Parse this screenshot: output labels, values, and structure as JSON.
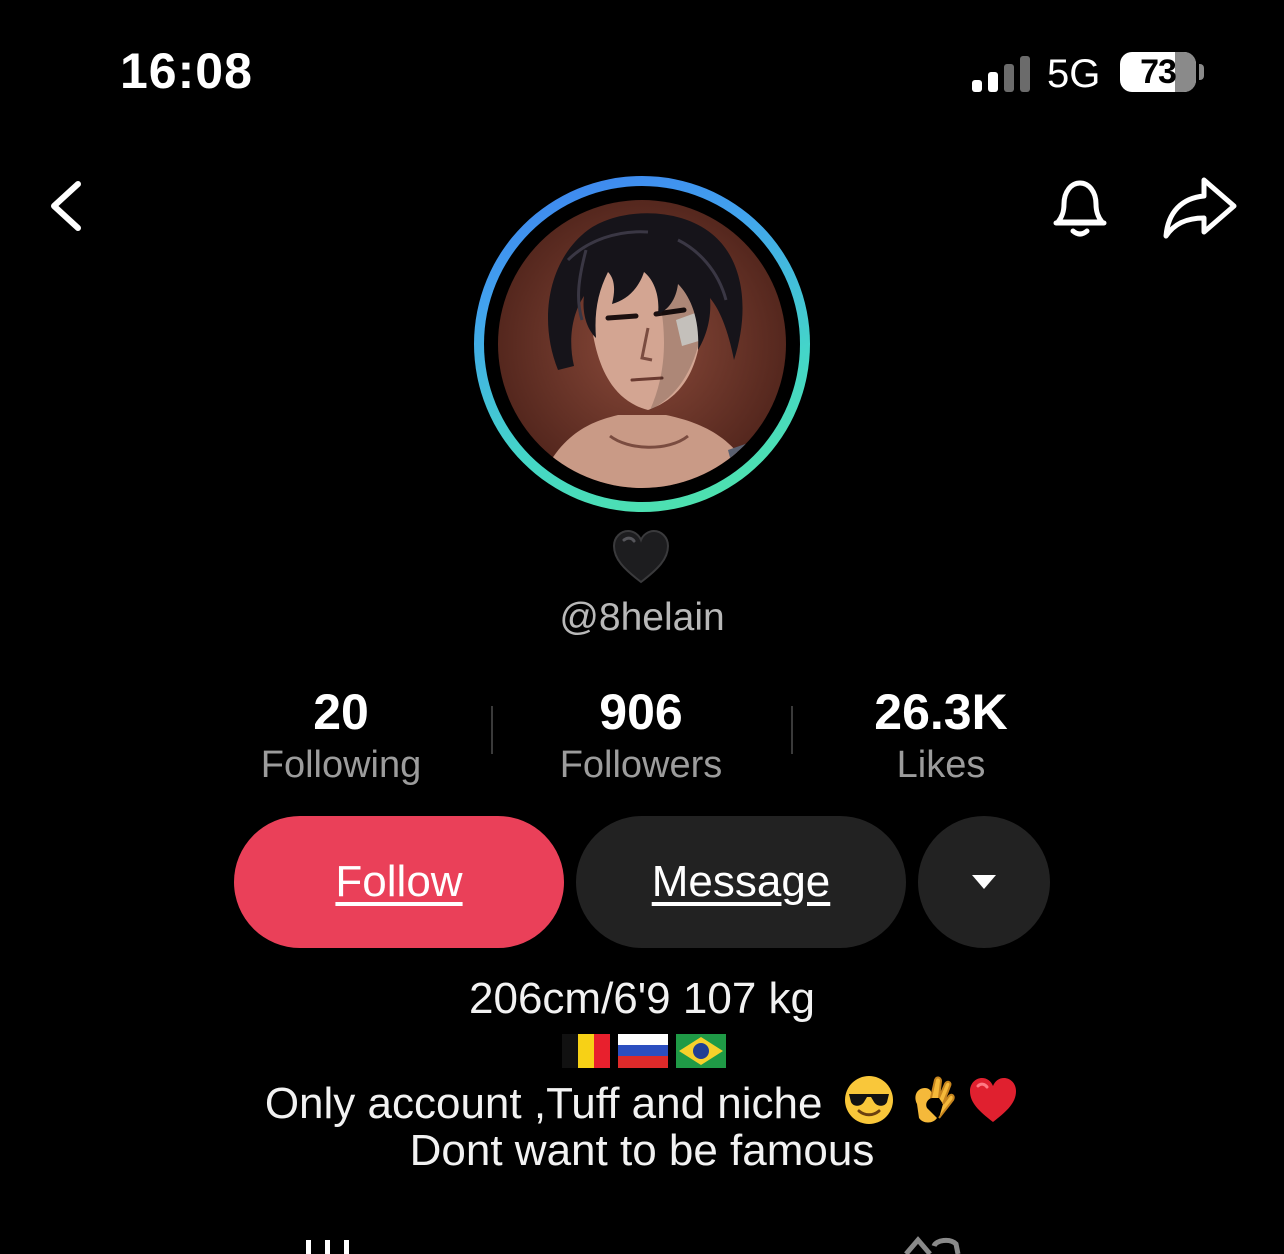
{
  "status_bar": {
    "time": "16:08",
    "network": "5G",
    "battery_level": "73",
    "battery_fraction": 0.73,
    "signal_bars_active": 2,
    "signal_bars_total": 4
  },
  "nav": {
    "back_icon": "chevron-left-icon",
    "bell_icon": "bell-icon",
    "share_icon": "share-arrow-icon"
  },
  "profile": {
    "name_emoji": "🖤",
    "username": "@8helain",
    "ring_colors": [
      "#3d7cf0",
      "#44d6c8",
      "#52e6a4"
    ]
  },
  "stats": [
    {
      "value": "20",
      "label": "Following"
    },
    {
      "value": "906",
      "label": "Followers"
    },
    {
      "value": "26.3K",
      "label": "Likes"
    }
  ],
  "actions": {
    "follow_label": "Follow",
    "message_label": "Message",
    "more_icon": "caret-down-icon",
    "follow_color": "#ea4059",
    "secondary_color": "#222222"
  },
  "bio": {
    "line1": "206cm/6'9 107 kg",
    "flags": [
      "belgium-flag",
      "russia-flag",
      "brazil-flag"
    ],
    "line3_text": "Only account ,Tuff and niche",
    "line3_emojis": [
      "smiling-face-with-sunglasses",
      "ok-hand",
      "red-heart"
    ],
    "line4": "Dont want to be famous"
  },
  "tabs": {
    "videos_icon": "grid-icon",
    "reposts_icon": "repost-icon"
  }
}
